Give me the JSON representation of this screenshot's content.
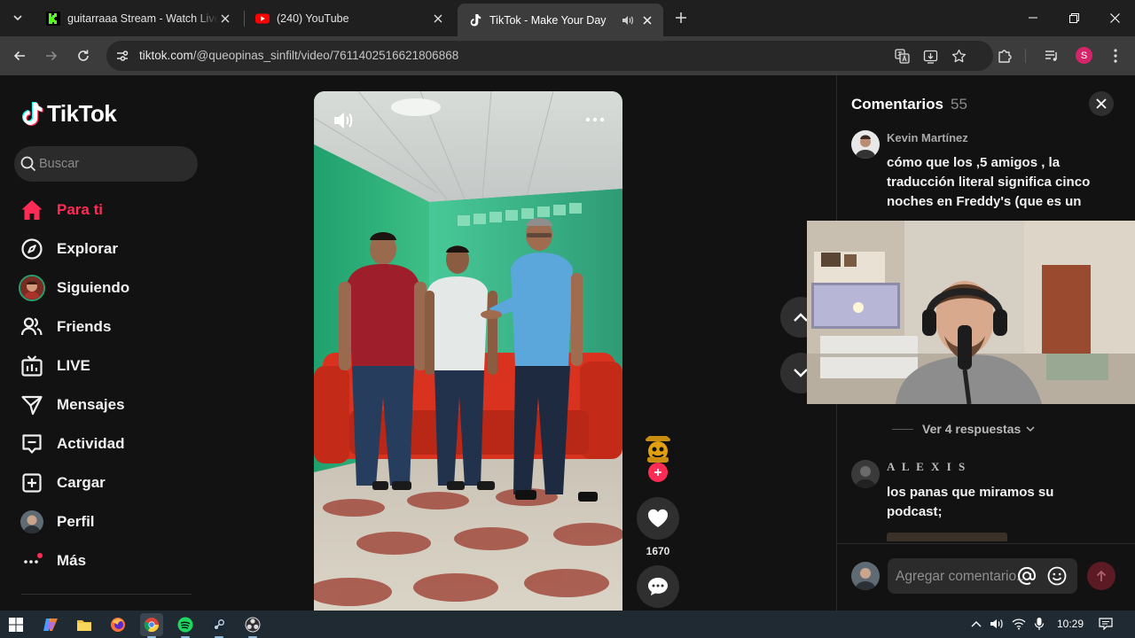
{
  "browser": {
    "tabs": [
      {
        "title": "guitarraaa Stream - Watch Live",
        "favicon": "kick-icon",
        "active": false
      },
      {
        "title": "(240) YouTube",
        "favicon": "youtube-icon",
        "active": false
      },
      {
        "title": "TikTok - Make Your Day",
        "favicon": "tiktok-icon",
        "active": true,
        "audio": true
      }
    ],
    "url_host": "tiktok.com",
    "url_path": "/@queopinas_sinfilt/video/7611402516621806868",
    "profile_initial": "S"
  },
  "tiktok": {
    "logo_text": "TikTok",
    "search_placeholder": "Buscar",
    "nav": [
      {
        "label": "Para ti",
        "icon": "home-icon",
        "active": true
      },
      {
        "label": "Explorar",
        "icon": "compass-icon"
      },
      {
        "label": "Siguiendo",
        "icon": "avatar"
      },
      {
        "label": "Friends",
        "icon": "friends-icon"
      },
      {
        "label": "LIVE",
        "icon": "live-tv-icon"
      },
      {
        "label": "Mensajes",
        "icon": "send-icon"
      },
      {
        "label": "Actividad",
        "icon": "activity-icon"
      },
      {
        "label": "Cargar",
        "icon": "upload-icon"
      },
      {
        "label": "Perfil",
        "icon": "avatar"
      },
      {
        "label": "Más",
        "icon": "more-dots-icon"
      }
    ],
    "video": {
      "like_count": "1670"
    },
    "comments": {
      "title": "Comentarios",
      "count": "55",
      "items": [
        {
          "user": "Kevin Martínez",
          "text": "cómo que los ,5 amigos , la traducción literal significa cinco noches en Freddy's (que es un"
        },
        {
          "user": "A L E X I S",
          "text": "los panas que miramos su podcast;"
        }
      ],
      "view_replies": "Ver 4 respuestas",
      "input_placeholder": "Agregar comentario...",
      "at_symbol": "@"
    }
  },
  "taskbar": {
    "apps": [
      "windows-start-icon",
      "copilot-icon",
      "file-explorer-icon",
      "firefox-icon",
      "chrome-icon",
      "spotify-icon",
      "steam-icon",
      "obs-icon"
    ],
    "time": "10:29"
  },
  "colors": {
    "accent": "#fe2c55",
    "page_bg": "#121212",
    "chrome_bg": "#1f1f1f"
  }
}
